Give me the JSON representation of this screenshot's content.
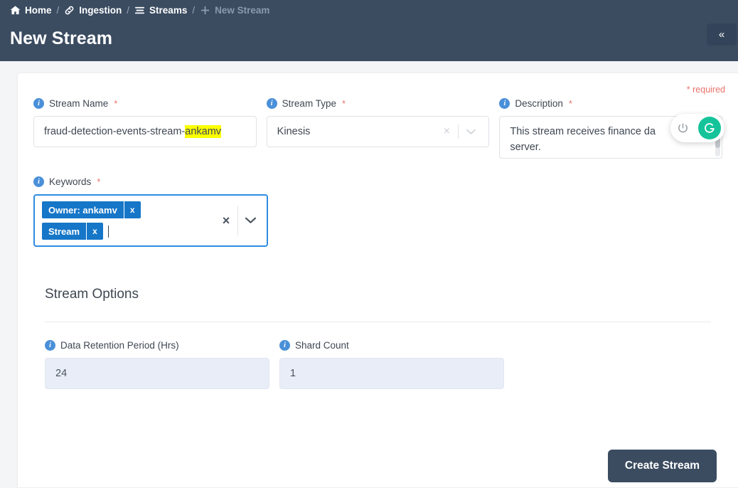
{
  "header": {
    "breadcrumb": [
      {
        "label": "Home",
        "icon": "home-icon",
        "active": true
      },
      {
        "label": "Ingestion",
        "icon": "link-icon",
        "active": true
      },
      {
        "label": "Streams",
        "icon": "stream-lines-icon",
        "active": true
      },
      {
        "label": "New Stream",
        "icon": "plus-icon",
        "active": false
      }
    ],
    "separator": "/",
    "title": "New Stream",
    "collapse_label": "«",
    "background_color": "#3b4c61"
  },
  "form": {
    "required_note": "* required",
    "required_marker": "*",
    "stream_name": {
      "label": "Stream Name",
      "value_plain": "fraud-detection-events-stream-",
      "value_highlighted": "ankamv",
      "highlight_color": "#fbff00"
    },
    "stream_type": {
      "label": "Stream Type",
      "value": "Kinesis",
      "clear_label": "×",
      "chevron_label": "⌄"
    },
    "description": {
      "label": "Description",
      "line1": "This stream receives finance da",
      "line2": "server."
    },
    "keywords": {
      "label": "Keywords",
      "chips": [
        {
          "label": "Owner: ankamv",
          "remove_label": "x"
        },
        {
          "label": "Stream",
          "remove_label": "x"
        }
      ],
      "clear_label": "×",
      "chevron_label": "⌄",
      "focus_color": "#2f8ce0",
      "chip_color": "#1676c8"
    }
  },
  "assist_widget": {
    "power_icon": "power-icon",
    "brand_icon": "grammarly-g-icon",
    "brand_color": "#15c39a"
  },
  "stream_options": {
    "title": "Stream Options",
    "fields": [
      {
        "label": "Data Retention Period (Hrs)",
        "value": "24"
      },
      {
        "label": "Shard Count",
        "value": "1"
      }
    ]
  },
  "footer": {
    "create_label": "Create Stream"
  }
}
